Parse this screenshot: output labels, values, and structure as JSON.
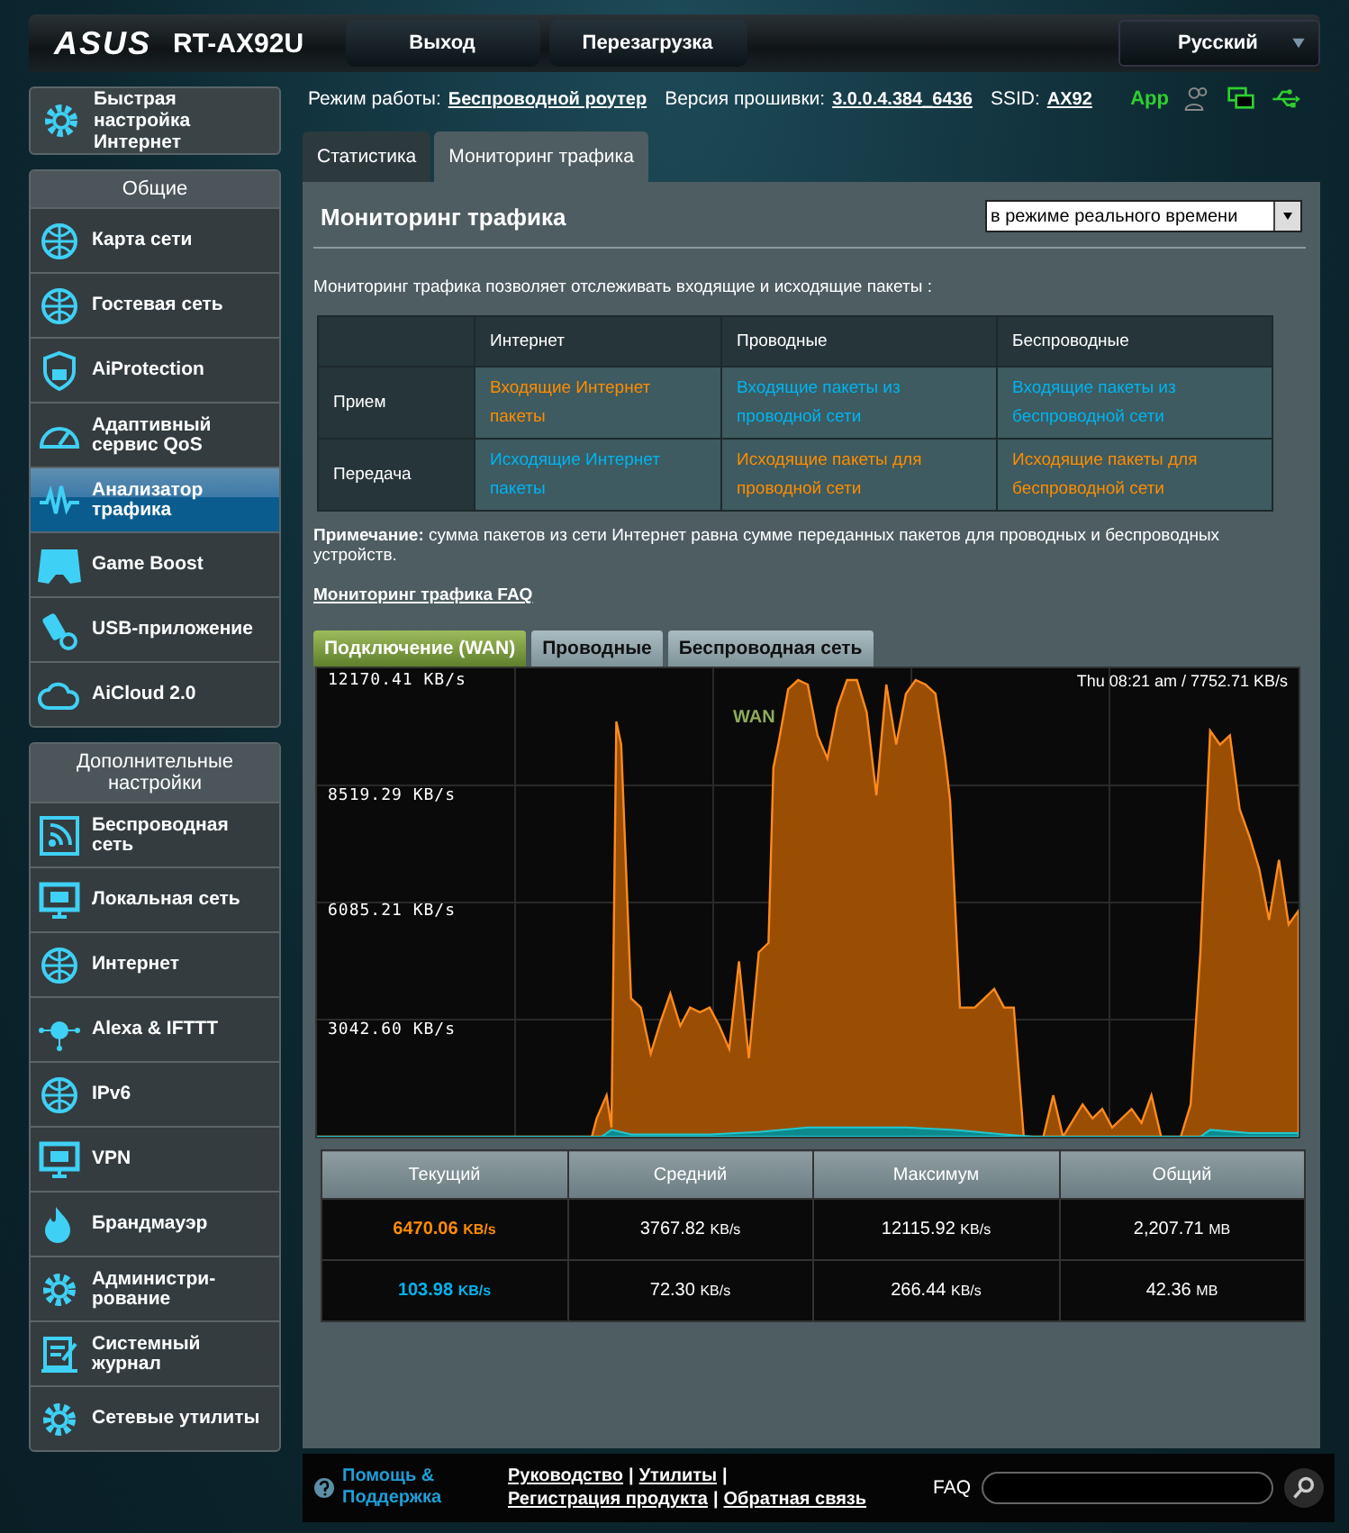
{
  "header": {
    "logo": "ASUS",
    "model": "RT-AX92U",
    "buttons": [
      "Выход",
      "Перезагрузка"
    ],
    "language": "Русский"
  },
  "status": {
    "mode_label": "Режим работы:",
    "mode": "Беспроводной роутер",
    "firmware_label": "Версия прошивки:",
    "firmware": "3.0.0.4.384_6436",
    "ssid_label": "SSID:",
    "ssid": "AX92",
    "app": "App"
  },
  "sidebar": {
    "quick_setup": "Быстрая настройка Интернет",
    "sections": [
      {
        "title": "Общие",
        "items": [
          {
            "label": "Карта сети",
            "selected": false
          },
          {
            "label": "Гостевая сеть",
            "selected": false
          },
          {
            "label": "AiProtection",
            "selected": false
          },
          {
            "label": "Адаптивный сервис QoS",
            "selected": false
          },
          {
            "label": "Анализатор трафика",
            "selected": true
          },
          {
            "label": "Game Boost",
            "selected": false
          },
          {
            "label": "USB-приложение",
            "selected": false
          },
          {
            "label": "AiCloud 2.0",
            "selected": false
          }
        ]
      },
      {
        "title": "Дополнительные настройки",
        "items": [
          {
            "label": "Беспроводная сеть",
            "selected": false
          },
          {
            "label": "Локальная сеть",
            "selected": false
          },
          {
            "label": "Интернет",
            "selected": false
          },
          {
            "label": "Alexa & IFTTT",
            "selected": false
          },
          {
            "label": "IPv6",
            "selected": false
          },
          {
            "label": "VPN",
            "selected": false
          },
          {
            "label": "Брандмауэр",
            "selected": false
          },
          {
            "label": "Администри-рование",
            "selected": false
          },
          {
            "label": "Системный журнал",
            "selected": false
          },
          {
            "label": "Сетевые утилиты",
            "selected": false
          }
        ]
      }
    ]
  },
  "tabs": [
    {
      "label": "Статистика",
      "selected": false
    },
    {
      "label": "Мониторинг трафика",
      "selected": true
    }
  ],
  "panel": {
    "title": "Мониторинг трафика",
    "mode_select": "в режиме реального времени",
    "description": "Мониторинг трафика позволяет отслеживать входящие и исходящие пакеты :",
    "table": {
      "columns": [
        "Интернет",
        "Проводные",
        "Беспроводные"
      ],
      "rows": [
        {
          "label": "Прием",
          "cells": [
            {
              "text": "Входящие Интернет пакеты",
              "highlighted": true
            },
            {
              "text": "Входящие пакеты из проводной сети",
              "highlighted": false
            },
            {
              "text": "Входящие пакеты из беспроводной сети",
              "highlighted": false
            }
          ]
        },
        {
          "label": "Передача",
          "cells": [
            {
              "text": "Исходящие Интернет пакеты",
              "highlighted": false
            },
            {
              "text": "Исходящие пакеты для проводной сети",
              "highlighted": true
            },
            {
              "text": "Исходящие пакеты для беспроводной сети",
              "highlighted": true
            }
          ]
        }
      ]
    },
    "note": "**Примечание:** сумма пакетов из сети Интернет равна сумме переданных пакетов для проводных и беспроводных устройств.",
    "faq_link": "Мониторинг трафика FAQ",
    "chart_tabs": [
      {
        "label": "Подключение (WAN)",
        "selected": true
      },
      {
        "label": "Проводные",
        "selected": false
      },
      {
        "label": "Беспроводная сеть",
        "selected": false
      }
    ],
    "chart": {
      "y_labels": [
        "12170.41 KB/s",
        "8519.29 KB/s",
        "6085.21 KB/s",
        "3042.60 KB/s"
      ],
      "timestamp": "Thu 08:21 am / 7752.71 KB/s",
      "series_label": "WAN"
    },
    "stats": {
      "columns": [
        "Текущий",
        "Средний",
        "Максимум",
        "Общий"
      ],
      "rows": [
        {
          "highlighted": true,
          "cells": [
            {
              "value": "6470.06",
              "unit": "KB/s"
            },
            {
              "value": "3767.82",
              "unit": "KB/s"
            },
            {
              "value": "12115.92",
              "unit": "KB/s"
            },
            {
              "value": "2,207.71",
              "unit": "MB"
            }
          ]
        },
        {
          "highlighted": false,
          "cells": [
            {
              "value": "103.98",
              "unit": "KB/s"
            },
            {
              "value": "72.30",
              "unit": "KB/s"
            },
            {
              "value": "266.44",
              "unit": "KB/s"
            },
            {
              "value": "42.36",
              "unit": "MB"
            }
          ]
        }
      ]
    }
  },
  "footer": {
    "help": "Помощь & Поддержка",
    "links": [
      {
        "kind": "link",
        "text": "Руководство"
      },
      {
        "kind": "separator",
        "text": "|"
      },
      {
        "kind": "link",
        "text": "Утилиты"
      },
      {
        "kind": "separator",
        "text": "|"
      },
      {
        "kind": "link",
        "text": "Регистрация продукта"
      },
      {
        "kind": "separator",
        "text": "|"
      },
      {
        "kind": "link",
        "text": "Обратная связь"
      }
    ],
    "faq_label": "FAQ"
  }
}
